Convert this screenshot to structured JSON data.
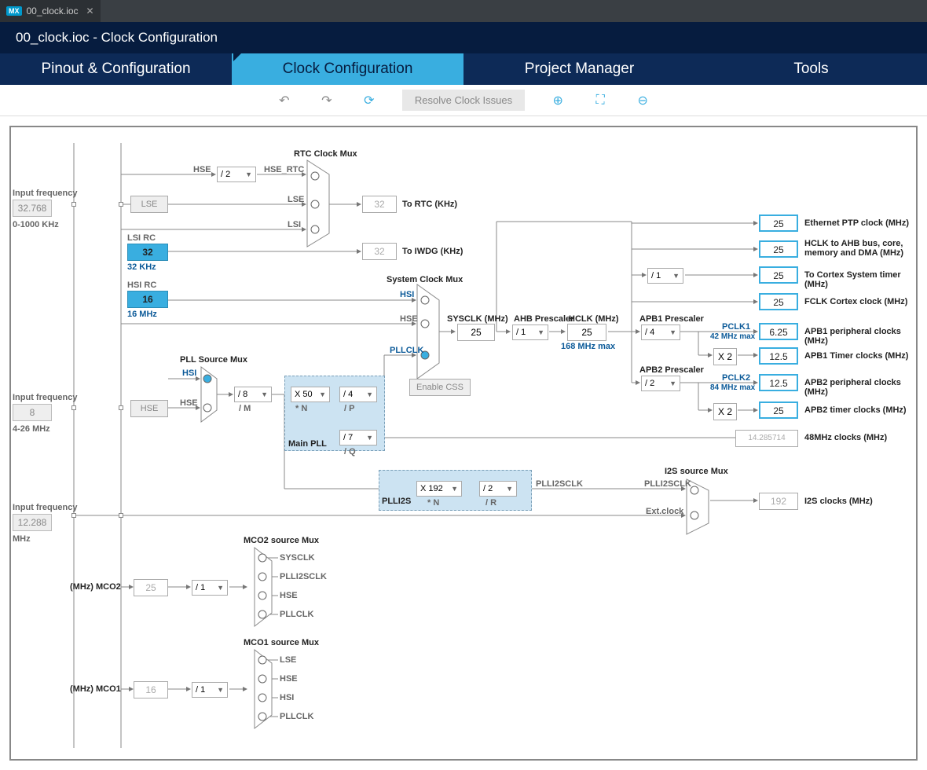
{
  "file_tab": {
    "badge": "MX",
    "name": "00_clock.ioc"
  },
  "breadcrumb": "00_clock.ioc - Clock Configuration",
  "tabs": {
    "pinout": "Pinout & Configuration",
    "clock": "Clock Configuration",
    "project": "Project Manager",
    "tools": "Tools"
  },
  "toolbar": {
    "resolve": "Resolve Clock Issues"
  },
  "inputs": {
    "lse_freq_label": "Input frequency",
    "lse_freq_val": "32.768",
    "lse_range": "0-1000 KHz",
    "hse_freq_label": "Input frequency",
    "hse_freq_val": "8",
    "hse_range": "4-26 MHz",
    "audio_freq_label": "Input frequency",
    "audio_freq_val": "12.288",
    "audio_unit": "MHz"
  },
  "osc": {
    "lse": "LSE",
    "lsi_rc": "LSI RC",
    "lsi_val": "32",
    "lsi_unit": "32 KHz",
    "hsi_rc": "HSI RC",
    "hsi_val": "16",
    "hsi_unit": "16 MHz",
    "hse": "HSE",
    "hse_short": "HSE",
    "hsi_short": "HSI",
    "lsi_short": "LSI",
    "lse_short": "LSE",
    "hse_rtc": "HSE_RTC"
  },
  "mux": {
    "rtc": "RTC Clock Mux",
    "sys": "System Clock Mux",
    "pll_src": "PLL Source Mux",
    "mco2": "MCO2 source Mux",
    "mco1": "MCO1 source Mux",
    "i2s": "I2S source Mux"
  },
  "pll": {
    "main": "Main PLL",
    "plli2s": "PLLI2S",
    "div_m": "/ 8",
    "div_m_lbl": "/ M",
    "mul_n": "X 50",
    "mul_n_lbl": "* N",
    "div_p": "/ 4",
    "div_p_lbl": "/ P",
    "div_q": "/ 7",
    "div_q_lbl": "/ Q",
    "i2s_mul_n": "X 192",
    "i2s_mul_n_lbl": "* N",
    "i2s_div_r": "/ 2",
    "i2s_div_r_lbl": "/ R",
    "div2": "/ 2"
  },
  "sys": {
    "hsi": "HSI",
    "hse": "HSE",
    "pllclk": "PLLCLK",
    "sysclk_lbl": "SYSCLK (MHz)",
    "sysclk_val": "25",
    "enable_css": "Enable CSS",
    "ahb_presc": "AHB Prescaler",
    "ahb_val": "/ 1",
    "hclk_lbl": "HCLK (MHz)",
    "hclk_val": "25",
    "hclk_max": "168 MHz max",
    "apb1_presc": "APB1 Prescaler",
    "apb1_val": "/ 4",
    "pclk1": "PCLK1",
    "pclk1_max": "42 MHz max",
    "apb1_x2": "X 2",
    "apb2_presc": "APB2 Prescaler",
    "apb2_val": "/ 2",
    "pclk2": "PCLK2",
    "pclk2_max": "84 MHz max",
    "apb2_x2": "X 2"
  },
  "outputs": {
    "rtc_lbl": "To RTC (KHz)",
    "rtc_val": "32",
    "iwdg_lbl": "To IWDG (KHz)",
    "iwdg_val": "32",
    "eth_lbl": "Ethernet PTP clock (MHz)",
    "eth_val": "25",
    "hclk_ahb_lbl": "HCLK to AHB bus, core, memory and DMA (MHz)",
    "hclk_ahb_val": "25",
    "cortex_timer_lbl": "To Cortex System timer (MHz)",
    "cortex_timer_val": "25",
    "cortex_div": "/ 1",
    "fclk_lbl": "FCLK Cortex clock (MHz)",
    "fclk_val": "25",
    "apb1_periph_lbl": "APB1 peripheral clocks (MHz)",
    "apb1_periph_val": "6.25",
    "apb1_timer_lbl": "APB1 Timer clocks (MHz)",
    "apb1_timer_val": "12.5",
    "apb2_periph_lbl": "APB2 peripheral clocks (MHz)",
    "apb2_periph_val": "12.5",
    "apb2_timer_lbl": "APB2 timer clocks (MHz)",
    "apb2_timer_val": "25",
    "usb48_lbl": "48MHz clocks (MHz)",
    "usb48_val": "14.285714",
    "i2s_lbl": "I2S clocks (MHz)",
    "i2s_val": "192",
    "plli2sclk": "PLLI2SCLK",
    "ext_clock": "Ext.clock"
  },
  "mco": {
    "mco2_lbl": "(MHz) MCO2",
    "mco2_val": "25",
    "mco2_div": "/ 1",
    "mco1_lbl": "(MHz) MCO1",
    "mco1_val": "16",
    "mco1_div": "/ 1",
    "sysclk": "SYSCLK",
    "plli2sclk": "PLLI2SCLK",
    "hse": "HSE",
    "pllclk": "PLLCLK",
    "lse": "LSE",
    "hsi": "HSI"
  }
}
